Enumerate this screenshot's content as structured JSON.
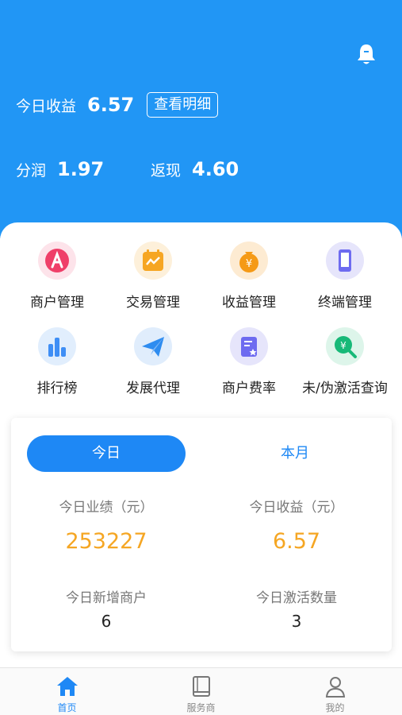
{
  "header": {
    "today_income_label": "今日收益",
    "today_income_value": "6.57",
    "detail_button": "查看明细",
    "profit_label": "分润",
    "profit_value": "1.97",
    "cashback_label": "返现",
    "cashback_value": "4.60"
  },
  "menu": [
    {
      "label": "商户管理",
      "icon": "merchant-icon",
      "color": "#EF3F69"
    },
    {
      "label": "交易管理",
      "icon": "transaction-icon",
      "color": "#F6A623"
    },
    {
      "label": "收益管理",
      "icon": "income-icon",
      "color": "#F59A16"
    },
    {
      "label": "终端管理",
      "icon": "terminal-icon",
      "color": "#6E6BF0"
    },
    {
      "label": "排行榜",
      "icon": "ranking-icon",
      "color": "#3E8EF5"
    },
    {
      "label": "发展代理",
      "icon": "paper-plane-icon",
      "color": "#2E8CF0"
    },
    {
      "label": "商户费率",
      "icon": "rate-icon",
      "color": "#6E6BF0"
    },
    {
      "label": "未/伪激活查询",
      "icon": "activation-search-icon",
      "color": "#17B978"
    }
  ],
  "stats": {
    "tab_today": "今日",
    "tab_month": "本月",
    "performance_label": "今日业绩（元）",
    "performance_value": "253227",
    "income_label": "今日收益（元）",
    "income_value": "6.57",
    "new_merchants_label": "今日新增商户",
    "new_merchants_value": "6",
    "activations_label": "今日激活数量",
    "activations_value": "3"
  },
  "tabbar": {
    "home": "首页",
    "provider": "服务商",
    "mine": "我的"
  },
  "colors": {
    "primary": "#2196F5",
    "accent_orange": "#F5A623"
  }
}
